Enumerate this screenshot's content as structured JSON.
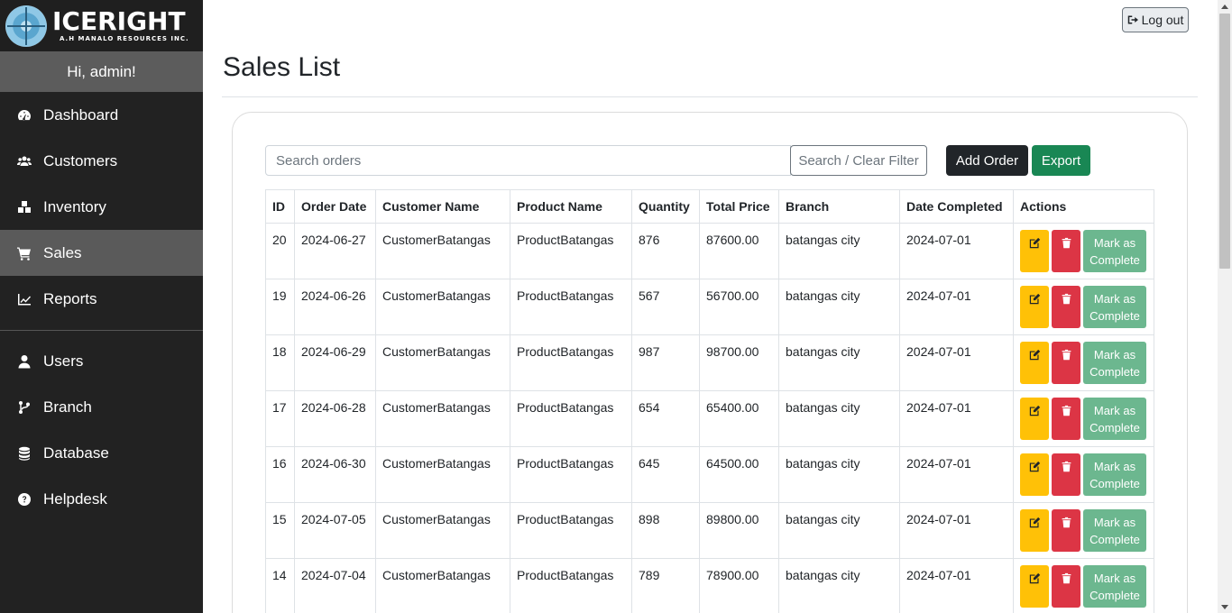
{
  "brand": {
    "name": "ICERIGHT",
    "subtitle": "A.H MANALO RESOURCES INC."
  },
  "greeting": "Hi, admin!",
  "sidebar": {
    "items": [
      {
        "label": "Dashboard",
        "icon": "dashboard-icon"
      },
      {
        "label": "Customers",
        "icon": "users-icon"
      },
      {
        "label": "Inventory",
        "icon": "boxes-icon"
      },
      {
        "label": "Sales",
        "icon": "cart-icon",
        "active": true
      },
      {
        "label": "Reports",
        "icon": "chart-icon"
      },
      {
        "label": "Users",
        "icon": "user-icon"
      },
      {
        "label": "Branch",
        "icon": "branch-icon"
      },
      {
        "label": "Database",
        "icon": "database-icon"
      },
      {
        "label": "Helpdesk",
        "icon": "question-icon"
      }
    ]
  },
  "header": {
    "logout_label": "Log out"
  },
  "page": {
    "title": "Sales List"
  },
  "toolbar": {
    "search_placeholder": "Search orders",
    "search_button": "Search / Clear Filter",
    "add_button": "Add Order",
    "export_button": "Export"
  },
  "table": {
    "columns": [
      "ID",
      "Order Date",
      "Customer Name",
      "Product Name",
      "Quantity",
      "Total Price",
      "Branch",
      "Date Completed",
      "Actions"
    ],
    "complete_label": "Mark as Complete",
    "rows": [
      {
        "id": "20",
        "order_date": "2024-06-27",
        "customer": "CustomerBatangas",
        "product": "ProductBatangas",
        "quantity": "876",
        "total": "87600.00",
        "branch": "batangas city",
        "completed": "2024-07-01"
      },
      {
        "id": "19",
        "order_date": "2024-06-26",
        "customer": "CustomerBatangas",
        "product": "ProductBatangas",
        "quantity": "567",
        "total": "56700.00",
        "branch": "batangas city",
        "completed": "2024-07-01"
      },
      {
        "id": "18",
        "order_date": "2024-06-29",
        "customer": "CustomerBatangas",
        "product": "ProductBatangas",
        "quantity": "987",
        "total": "98700.00",
        "branch": "batangas city",
        "completed": "2024-07-01"
      },
      {
        "id": "17",
        "order_date": "2024-06-28",
        "customer": "CustomerBatangas",
        "product": "ProductBatangas",
        "quantity": "654",
        "total": "65400.00",
        "branch": "batangas city",
        "completed": "2024-07-01"
      },
      {
        "id": "16",
        "order_date": "2024-06-30",
        "customer": "CustomerBatangas",
        "product": "ProductBatangas",
        "quantity": "645",
        "total": "64500.00",
        "branch": "batangas city",
        "completed": "2024-07-01"
      },
      {
        "id": "15",
        "order_date": "2024-07-05",
        "customer": "CustomerBatangas",
        "product": "ProductBatangas",
        "quantity": "898",
        "total": "89800.00",
        "branch": "batangas city",
        "completed": "2024-07-01"
      },
      {
        "id": "14",
        "order_date": "2024-07-04",
        "customer": "CustomerBatangas",
        "product": "ProductBatangas",
        "quantity": "789",
        "total": "78900.00",
        "branch": "batangas city",
        "completed": "2024-07-01"
      }
    ]
  },
  "colors": {
    "sidebar": "#222222",
    "active": "#5a5a5a",
    "edit": "#ffc107",
    "delete": "#dc3545",
    "complete": "#6cb78f",
    "export": "#198754"
  }
}
